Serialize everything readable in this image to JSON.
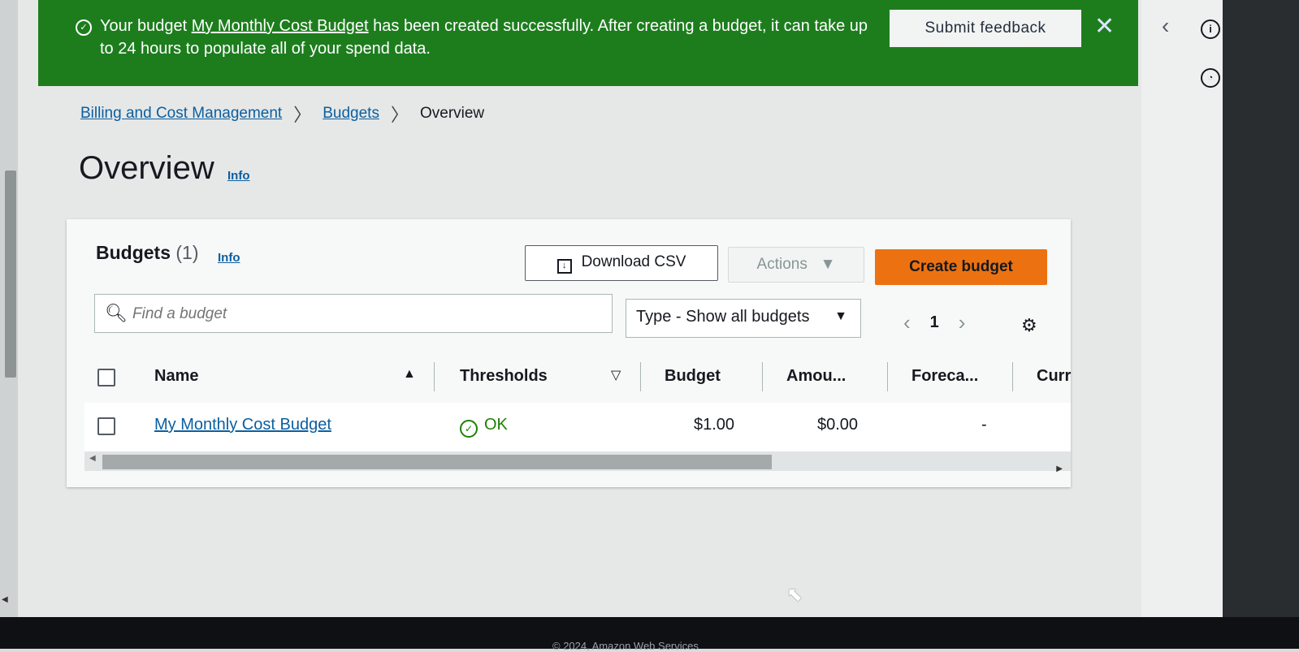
{
  "flash": {
    "prefix": "Your budget ",
    "budget_link": "My Monthly Cost Budget",
    "suffix": " has been created successfully. After creating a budget, it can take up to 24 hours to populate all of your spend data.",
    "feedback_label": "Submit feedback",
    "close_icon": "✕",
    "status_icon": "check-circle-icon"
  },
  "breadcrumb": {
    "items": [
      "Billing and Cost Management",
      "Budgets",
      "Overview"
    ]
  },
  "page": {
    "title": "Overview",
    "info_label": "Info"
  },
  "panel": {
    "title": "Budgets",
    "count": "(1)",
    "info_label": "Info",
    "download_label": "Download CSV",
    "actions_label": "Actions",
    "create_label": "Create budget",
    "search_placeholder": "Find a budget",
    "type_filter": "Type - Show all budgets",
    "page_number": "1"
  },
  "table": {
    "columns": [
      "Name",
      "Thresholds",
      "Budget",
      "Amou...",
      "Foreca...",
      "Curr"
    ],
    "rows": [
      {
        "name": "My Monthly Cost Budget",
        "thresholds": "OK",
        "budget": "$1.00",
        "amount": "$0.00",
        "forecast": "-"
      }
    ]
  },
  "footer": {
    "text": "© 2024, Amazon Web Services"
  },
  "colors": {
    "flash_bg": "#1d7d1d",
    "link": "#0b5fa0",
    "primary_button": "#ec7211",
    "ok_status": "#1d8102"
  }
}
